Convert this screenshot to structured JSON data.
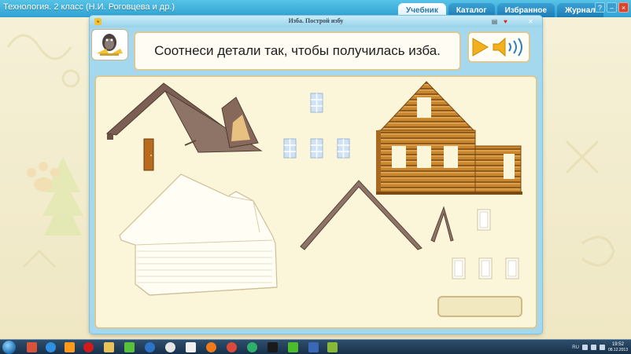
{
  "window": {
    "title": "Технология. 2 класс (Н.И. Роговцева и др.)",
    "tabs": [
      {
        "label": "Учебник",
        "active": true
      },
      {
        "label": "Каталог",
        "active": false
      },
      {
        "label": "Избранное",
        "active": false
      },
      {
        "label": "Журнал",
        "active": false
      }
    ],
    "controls": [
      "?",
      "–",
      "×"
    ]
  },
  "activity": {
    "title": "Изба. Построй избу",
    "close_glyph": "✕",
    "instruction": "Соотнеси детали так, чтобы получилась изба."
  },
  "icons": {
    "mascot": "beaver-mascot-icon",
    "play": "play-icon",
    "volume": "speaker-icon",
    "print": "printer-icon",
    "favorite": "heart-icon"
  },
  "colors": {
    "topbar": "#2fa2d3",
    "log": "#c8872e",
    "roof": "#7a5f52",
    "window_glass": "#cfe3f5",
    "accent_play": "#f2b01e"
  },
  "taskbar": {
    "language": "RU",
    "time": "19:52",
    "date": "08.12.2013"
  }
}
